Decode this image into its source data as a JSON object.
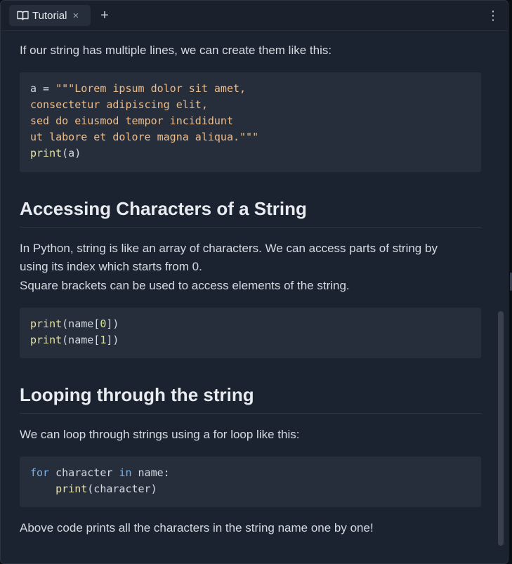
{
  "tabbar": {
    "active_tab": {
      "label": "Tutorial",
      "icon": "book-open-icon",
      "close_glyph": "×"
    },
    "add_tab_glyph": "+",
    "menu_glyph": "⋮"
  },
  "content": {
    "intro_text": "If our string has multiple lines, we can create them like this:",
    "code_multiline": {
      "lines": [
        [
          {
            "t": "txt",
            "v": "a = "
          },
          {
            "t": "str",
            "v": "\"\"\"Lorem ipsum dolor sit amet,"
          }
        ],
        [
          {
            "t": "str",
            "v": "consectetur adipiscing elit,"
          }
        ],
        [
          {
            "t": "str",
            "v": "sed do eiusmod tempor incididunt"
          }
        ],
        [
          {
            "t": "str",
            "v": "ut labore et dolore magna aliqua.\"\"\""
          }
        ],
        [
          {
            "t": "fn",
            "v": "print"
          },
          {
            "t": "txt",
            "v": "(a)"
          }
        ]
      ]
    },
    "section_accessing": {
      "heading": "Accessing Characters of a String",
      "para_line1": "In Python, string is like an array of characters. We can access parts of string by",
      "para_line2": "using its index which starts from 0.",
      "para_line3": "Square brackets can be used to access elements of the string.",
      "code": {
        "lines": [
          [
            {
              "t": "fn",
              "v": "print"
            },
            {
              "t": "txt",
              "v": "(name["
            },
            {
              "t": "num",
              "v": "0"
            },
            {
              "t": "txt",
              "v": "])"
            }
          ],
          [
            {
              "t": "fn",
              "v": "print"
            },
            {
              "t": "txt",
              "v": "(name["
            },
            {
              "t": "num",
              "v": "1"
            },
            {
              "t": "txt",
              "v": "])"
            }
          ]
        ]
      }
    },
    "section_looping": {
      "heading": "Looping through the string",
      "para": "We can loop through strings using a for loop like this:",
      "code": {
        "lines": [
          [
            {
              "t": "kw",
              "v": "for"
            },
            {
              "t": "txt",
              "v": " character "
            },
            {
              "t": "kw",
              "v": "in"
            },
            {
              "t": "txt",
              "v": " name:"
            }
          ],
          [
            {
              "t": "txt",
              "v": "    "
            },
            {
              "t": "fn",
              "v": "print"
            },
            {
              "t": "txt",
              "v": "(character)"
            }
          ]
        ]
      },
      "closing": "Above code prints all the characters in the string name one by one!"
    }
  },
  "colors": {
    "background": "#1b2230",
    "code_background": "#262d3b",
    "keyword": "#7fb0e3",
    "string": "#eebd8a",
    "function": "#e9e3a3",
    "number": "#d7e79a"
  }
}
